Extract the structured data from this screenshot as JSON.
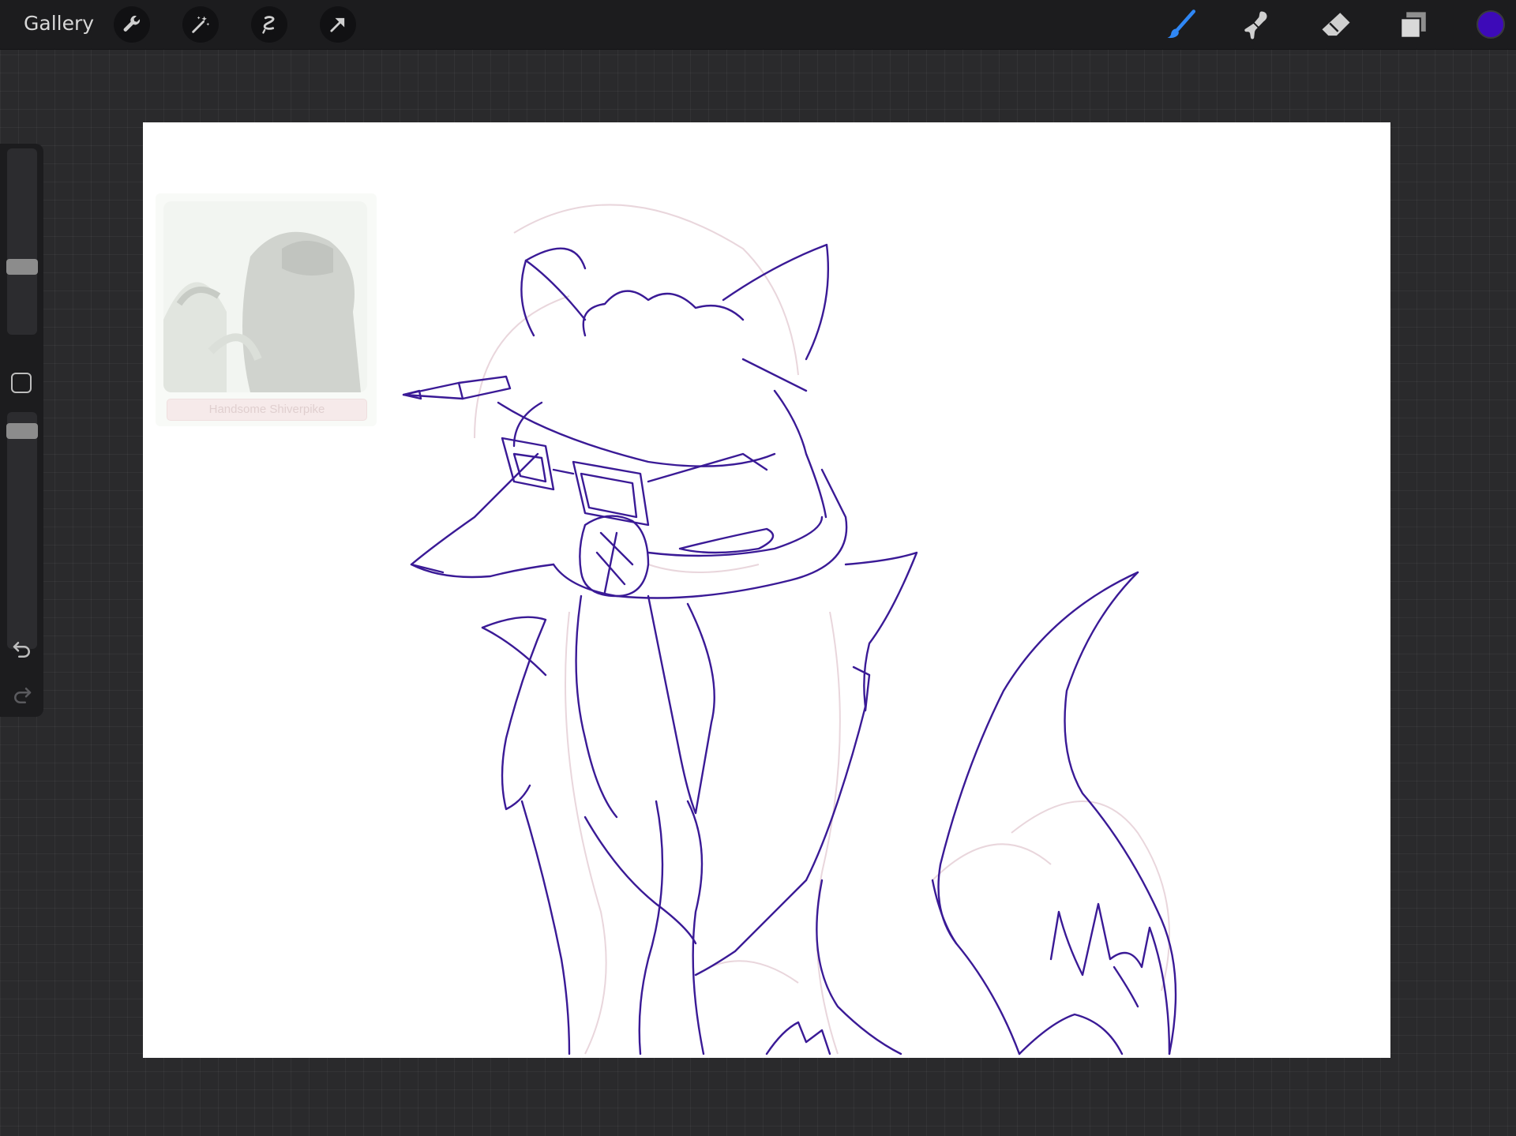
{
  "toolbar": {
    "gallery_label": "Gallery",
    "left_icons": [
      "wrench-icon",
      "magic-wand-icon",
      "selection-icon",
      "transform-arrow-icon"
    ],
    "right_icons": [
      "brush-icon",
      "smudge-icon",
      "eraser-icon",
      "layers-icon"
    ],
    "active_tool": "brush",
    "active_color": "#3d0ab8"
  },
  "sidebar": {
    "brush_size_level": 0.35,
    "opacity_level": 0.95,
    "undo_icon": "undo-icon",
    "redo_icon": "redo-icon"
  },
  "canvas": {
    "background": "#ffffff",
    "stroke_color": "#3a1a96",
    "reference_label": "Handsome Shiverpike"
  }
}
